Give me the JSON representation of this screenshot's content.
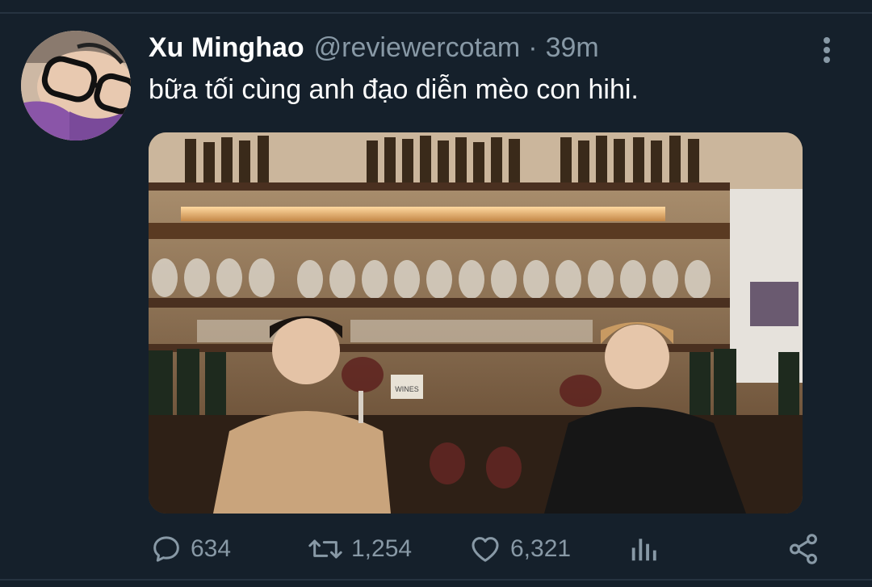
{
  "tweet": {
    "author_name": "Xu Minghao",
    "handle": "@reviewercotam",
    "separator": "·",
    "time": "39m",
    "text": "bữa tối cùng anh đạo diễn mèo con hihi."
  },
  "actions": {
    "reply_count": "634",
    "retweet_count": "1,254",
    "like_count": "6,321"
  },
  "media": {
    "sign_text": "WINES"
  },
  "icons": {
    "more": "more-vertical-icon",
    "reply": "reply-icon",
    "retweet": "retweet-icon",
    "like": "heart-icon",
    "analytics": "analytics-icon",
    "share": "share-icon"
  },
  "colors": {
    "background": "#15202b",
    "secondary_text": "#8899a6",
    "primary_text": "#ffffff"
  }
}
